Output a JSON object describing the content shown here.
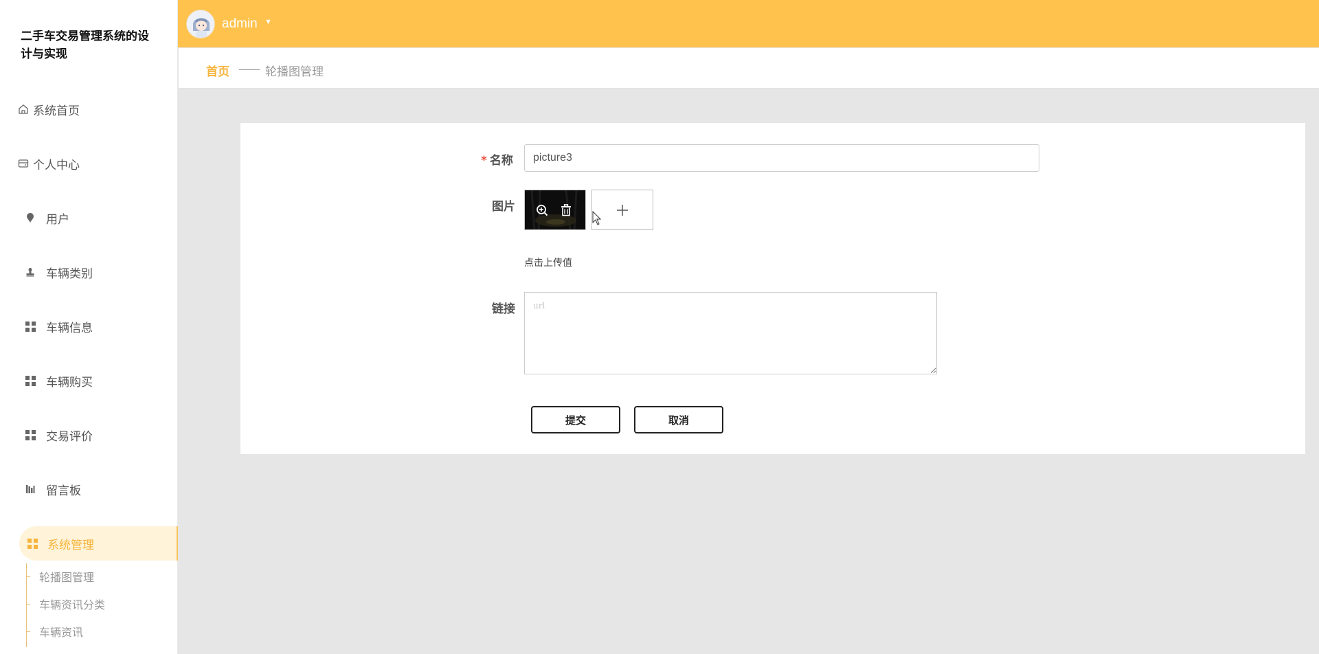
{
  "app": {
    "title_line1": "二手车交易管理系统的设",
    "title_line2": "计与实现"
  },
  "sidebar": {
    "items": [
      {
        "label": "系统首页",
        "icon": "home-icon"
      },
      {
        "label": "个人中心",
        "icon": "wallet-icon"
      },
      {
        "label": "用户",
        "icon": "pin-icon"
      },
      {
        "label": "车辆类别",
        "icon": "stamp-icon"
      },
      {
        "label": "车辆信息",
        "icon": "grid-icon"
      },
      {
        "label": "车辆购买",
        "icon": "grid-icon"
      },
      {
        "label": "交易评价",
        "icon": "grid-icon"
      },
      {
        "label": "留言板",
        "icon": "chart-icon"
      },
      {
        "label": "系统管理",
        "icon": "grid-icon",
        "active": true
      }
    ],
    "sub_items": [
      "轮播图管理",
      "车辆资讯分类",
      "车辆资讯"
    ]
  },
  "header": {
    "username": "admin"
  },
  "breadcrumb": {
    "home": "首页",
    "current": "轮播图管理"
  },
  "form": {
    "name_label": "名称",
    "required_mark": "*",
    "name_value": "picture3",
    "image_label": "图片",
    "upload_hint": "点击上传值",
    "link_label": "链接",
    "link_placeholder": "url",
    "submit_label": "提交",
    "cancel_label": "取消"
  },
  "colors": {
    "accent": "#fec24d",
    "active_text": "#f5b43c",
    "required": "#e74c3c"
  }
}
